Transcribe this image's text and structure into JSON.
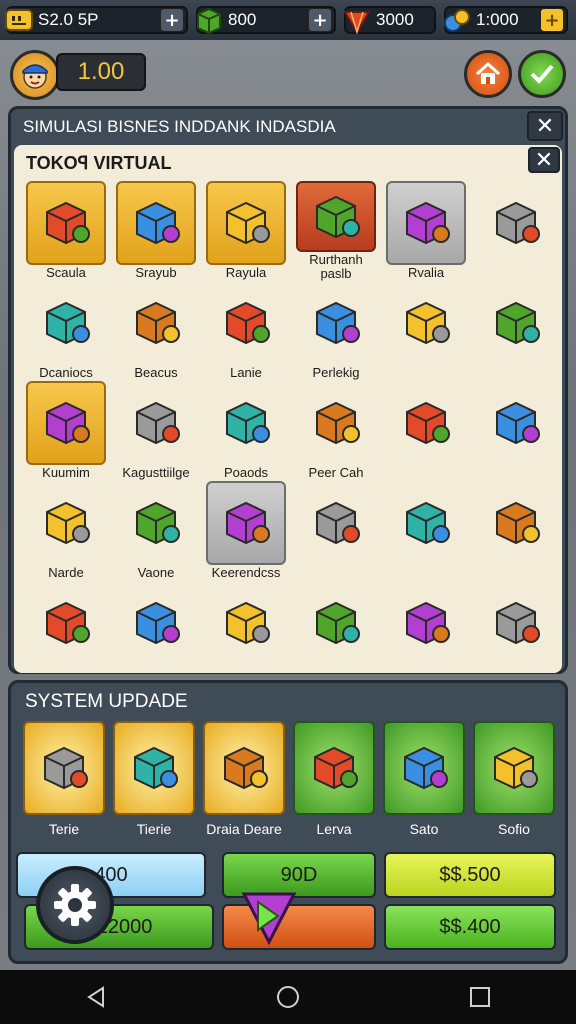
{
  "resources": [
    {
      "name": "cash",
      "value": "S2.0 5P",
      "icon": "cash-icon"
    },
    {
      "name": "stock",
      "value": "800",
      "icon": "box-icon"
    },
    {
      "name": "energy",
      "value": "3000",
      "icon": "gem-icon"
    },
    {
      "name": "gems",
      "value": "1:000",
      "icon": "crystal-icon"
    }
  ],
  "player": {
    "level_value": "1.00"
  },
  "main_panel": {
    "title": "SIMULASI BISNES INDDANK INDASDIA",
    "close_symbol": "✕",
    "inner_title": "TOKOꟼ VIRTUAL",
    "inner_close_symbol": "✕",
    "items": [
      {
        "label": "Scaula",
        "frame": "gold",
        "icon": "shop-stall-icon"
      },
      {
        "label": "Srayub",
        "frame": "gold",
        "icon": "cart-icon"
      },
      {
        "label": "Rayula",
        "frame": "gold",
        "icon": "storefront-icon"
      },
      {
        "label": "Rurthanh paslb",
        "frame": "red",
        "icon": "books-icon"
      },
      {
        "label": "Rvalia",
        "frame": "grey",
        "icon": "binder-icon"
      },
      {
        "label": "",
        "frame": "none",
        "icon": "crate-icon"
      },
      {
        "label": "Dcaniocs",
        "frame": "none",
        "icon": "market-icon"
      },
      {
        "label": "Beacus",
        "frame": "none",
        "icon": "cube-icon"
      },
      {
        "label": "Lanie",
        "frame": "none",
        "icon": "package-icon"
      },
      {
        "label": "Perlekig",
        "frame": "none",
        "icon": "machine-icon"
      },
      {
        "label": "",
        "frame": "none",
        "icon": "grey-box-icon"
      },
      {
        "label": "",
        "frame": "none",
        "icon": "green-box-icon"
      },
      {
        "label": "Kuumim",
        "frame": "gold",
        "icon": "cabinet-icon"
      },
      {
        "label": "Kagusttiilge",
        "frame": "none",
        "icon": "crate-green-icon"
      },
      {
        "label": "Poaods",
        "frame": "none",
        "icon": "shop-icon"
      },
      {
        "label": "Peer Cah",
        "frame": "none",
        "icon": "counter-icon"
      },
      {
        "label": "",
        "frame": "none",
        "icon": "card-icon"
      },
      {
        "label": "",
        "frame": "none",
        "icon": "green-cube-icon"
      },
      {
        "label": "Narde",
        "frame": "none",
        "icon": "book-icon"
      },
      {
        "label": "Vaone",
        "frame": "none",
        "icon": "basket-icon"
      },
      {
        "label": "Keerendcss",
        "frame": "grey",
        "icon": "leaf-box-icon"
      },
      {
        "label": "",
        "frame": "none",
        "icon": "fruit-basket-icon"
      },
      {
        "label": "",
        "frame": "none",
        "icon": "safe-icon"
      },
      {
        "label": "",
        "frame": "none",
        "icon": "boxes-icon"
      },
      {
        "label": "",
        "frame": "none",
        "icon": "green-stack-icon"
      },
      {
        "label": "",
        "frame": "none",
        "icon": "veg-crate-icon"
      },
      {
        "label": "",
        "frame": "none",
        "icon": "cherry-box-icon"
      },
      {
        "label": "",
        "frame": "none",
        "icon": "produce-cart-icon"
      },
      {
        "label": "",
        "frame": "none",
        "icon": "tray-icon"
      },
      {
        "label": "",
        "frame": "none",
        "icon": "blue-box-icon"
      }
    ]
  },
  "system_panel": {
    "title": "SYSTEM UPDADE",
    "upgrades": [
      {
        "label": "Terie",
        "frame": "gold",
        "icon": "stall-icon"
      },
      {
        "label": "Tierie",
        "frame": "gold",
        "icon": "cart-icon"
      },
      {
        "label": "Draia Deare",
        "frame": "gold",
        "icon": "cart-full-icon"
      },
      {
        "label": "Lerva",
        "frame": "green",
        "icon": "house-icon"
      },
      {
        "label": "Sato",
        "frame": "green",
        "icon": "jar-icon"
      },
      {
        "label": "Sofio",
        "frame": "green",
        "icon": "register-icon"
      }
    ],
    "prices": [
      "400",
      "90D",
      "$$.500",
      "122000",
      "",
      "$$.400"
    ]
  },
  "colors": {
    "accent_gold": "#f3c12b",
    "panel": "#404b58",
    "cream": "#f3ecd8"
  }
}
